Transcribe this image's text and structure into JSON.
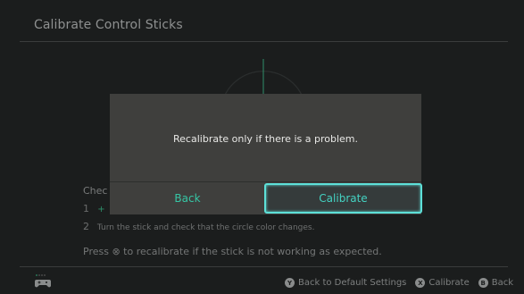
{
  "header": {
    "title": "Calibrate Control Sticks"
  },
  "background": {
    "check_label": "Chec",
    "step1_num": "1",
    "step1_symbol": "+",
    "step2_num": "2",
    "step2_text": "Turn the stick and check that the circle color changes.",
    "press_text": "Press ⊗ to recalibrate if the stick is not working as expected."
  },
  "dialog": {
    "message": "Recalibrate only if there is a problem.",
    "back_label": "Back",
    "calibrate_label": "Calibrate"
  },
  "footer": {
    "hints": [
      {
        "glyph": "Y",
        "label": "Back to Default Settings"
      },
      {
        "glyph": "X",
        "label": "Calibrate"
      },
      {
        "glyph": "B",
        "label": "Back"
      }
    ]
  },
  "colors": {
    "accent": "#36c6a5",
    "focus_border": "#5de0d8",
    "dialog_bg": "#3f3f3d",
    "page_bg": "#1b1d1d"
  }
}
